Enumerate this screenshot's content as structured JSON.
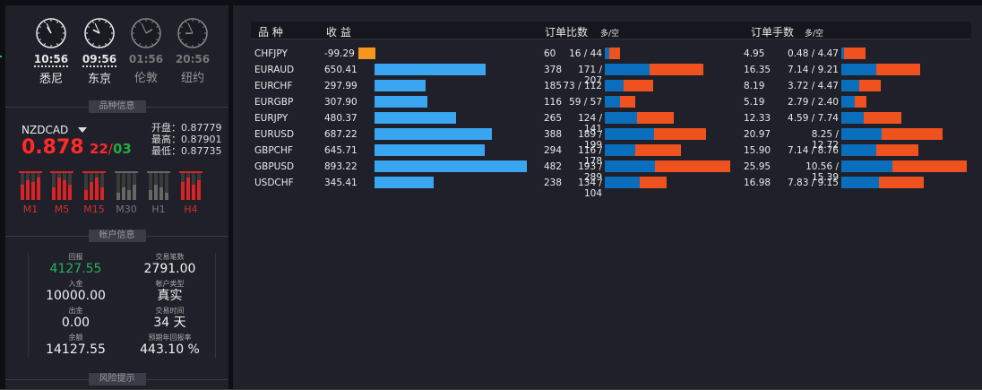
{
  "clocks": [
    {
      "time": "10:56",
      "city": "悉尼",
      "dim": false,
      "hour": 10,
      "minute": 56
    },
    {
      "time": "09:56",
      "city": "东京",
      "dim": false,
      "hour": 9,
      "minute": 56
    },
    {
      "time": "01:56",
      "city": "伦敦",
      "dim": true,
      "hour": 1,
      "minute": 56
    },
    {
      "time": "20:56",
      "city": "纽约",
      "dim": true,
      "hour": 20,
      "minute": 56
    }
  ],
  "symbol_section": {
    "title": "品种信息",
    "symbol": "NZDCAD",
    "price_main": "0.878",
    "price_pip": "22",
    "price_slash": "/",
    "price_pip2": "03",
    "open_label": "开盘：",
    "open": "0.87779",
    "high_label": "最高：",
    "high": "0.87901",
    "low_label": "最低：",
    "low": "0.87735",
    "timeframes": [
      {
        "label": "M1",
        "dim": false
      },
      {
        "label": "M5",
        "dim": false
      },
      {
        "label": "M15",
        "dim": false
      },
      {
        "label": "M30",
        "dim": true
      },
      {
        "label": "H1",
        "dim": true
      },
      {
        "label": "H4",
        "dim": false
      }
    ]
  },
  "account_section": {
    "title": "帐户信息",
    "profit_label": "回报",
    "profit": "4127.55",
    "trades_label": "交易笔数",
    "trades": "2791.00",
    "deposit_label": "入金",
    "deposit": "10000.00",
    "type_label": "帐户类型",
    "type": "真实",
    "withdraw_label": "出金",
    "withdraw": "0.00",
    "days_label": "交易时间",
    "days": "34 天",
    "balance_label": "余额",
    "balance": "14127.55",
    "annual_label": "预期年回报率",
    "annual": "443.10 %"
  },
  "risk_section": {
    "title": "风险提示"
  },
  "table": {
    "col_symbol": "品 种",
    "col_profit": "收 益",
    "col_orders": "订单比数",
    "col_orders_sub": "多/空",
    "col_lots": "订单手数",
    "col_lots_sub": "多/空",
    "profit_color_pos": "#3aa5f0",
    "profit_color_neg": "#f5971f",
    "long_color": "#0a6ebd",
    "short_color": "#f0521f",
    "rows": [
      {
        "symbol": "CHFJPY",
        "profit": "-99.29",
        "p": -99.29,
        "orders_total": "60",
        "orders": "16 / 44",
        "ol": 16,
        "os": 44,
        "lots_total": "4.95",
        "lots": "0.48 / 4.47",
        "ll": 0.48,
        "ls": 4.47
      },
      {
        "symbol": "EURAUD",
        "profit": "650.41",
        "p": 650.41,
        "orders_total": "378",
        "orders": "171 / 207",
        "ol": 171,
        "os": 207,
        "lots_total": "16.35",
        "lots": "7.14 / 9.21",
        "ll": 7.14,
        "ls": 9.21
      },
      {
        "symbol": "EURCHF",
        "profit": "297.99",
        "p": 297.99,
        "orders_total": "185",
        "orders": "73 / 112",
        "ol": 73,
        "os": 112,
        "lots_total": "8.19",
        "lots": "3.72 / 4.47",
        "ll": 3.72,
        "ls": 4.47
      },
      {
        "symbol": "EURGBP",
        "profit": "307.90",
        "p": 307.9,
        "orders_total": "116",
        "orders": "59 / 57",
        "ol": 59,
        "os": 57,
        "lots_total": "5.19",
        "lots": "2.79 / 2.40",
        "ll": 2.79,
        "ls": 2.4
      },
      {
        "symbol": "EURJPY",
        "profit": "480.37",
        "p": 480.37,
        "orders_total": "265",
        "orders": "124 / 141",
        "ol": 124,
        "os": 141,
        "lots_total": "12.33",
        "lots": "4.59 / 7.74",
        "ll": 4.59,
        "ls": 7.74
      },
      {
        "symbol": "EURUSD",
        "profit": "687.22",
        "p": 687.22,
        "orders_total": "388",
        "orders": "189 / 199",
        "ol": 189,
        "os": 199,
        "lots_total": "20.97",
        "lots": "8.25 / 12.72",
        "ll": 8.25,
        "ls": 12.72
      },
      {
        "symbol": "GBPCHF",
        "profit": "645.71",
        "p": 645.71,
        "orders_total": "294",
        "orders": "116 / 178",
        "ol": 116,
        "os": 178,
        "lots_total": "15.90",
        "lots": "7.14 / 8.76",
        "ll": 7.14,
        "ls": 8.76
      },
      {
        "symbol": "GBPUSD",
        "profit": "893.22",
        "p": 893.22,
        "orders_total": "482",
        "orders": "193 / 289",
        "ol": 193,
        "os": 289,
        "lots_total": "25.95",
        "lots": "10.56 / 15.39",
        "ll": 10.56,
        "ls": 15.39
      },
      {
        "symbol": "USDCHF",
        "profit": "345.41",
        "p": 345.41,
        "orders_total": "238",
        "orders": "134 / 104",
        "ol": 134,
        "os": 104,
        "lots_total": "16.98",
        "lots": "7.83 / 9.15",
        "ll": 7.83,
        "ls": 9.15
      }
    ]
  }
}
